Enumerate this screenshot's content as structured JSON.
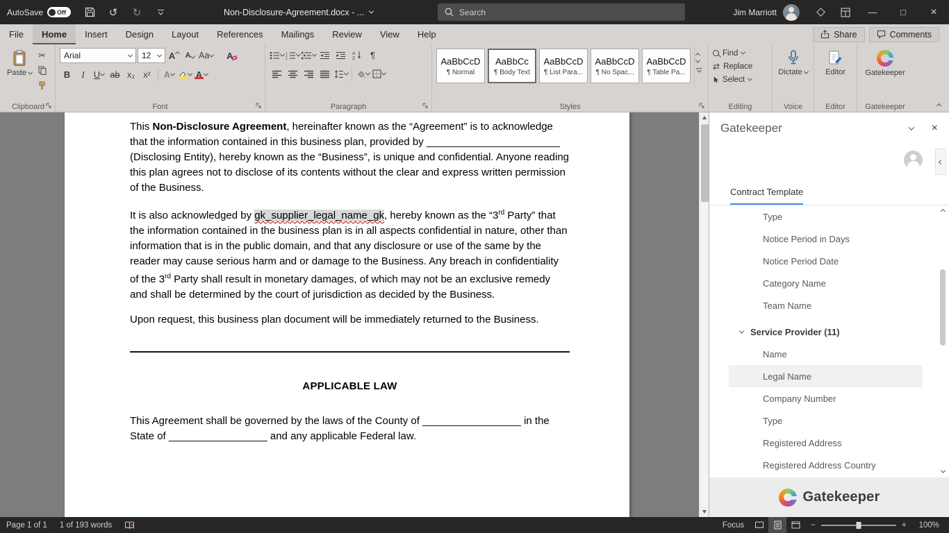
{
  "titlebar": {
    "autosave_label": "AutoSave",
    "autosave_state": "Off",
    "doc_title": "Non-Disclosure-Agreement.docx - ...",
    "search_placeholder": "Search",
    "user_name": "Jim Marriott"
  },
  "menubar": {
    "tabs": [
      "File",
      "Home",
      "Insert",
      "Design",
      "Layout",
      "References",
      "Mailings",
      "Review",
      "View",
      "Help"
    ],
    "active_tab": "Home",
    "share_label": "Share",
    "comments_label": "Comments"
  },
  "ribbon": {
    "clipboard": {
      "group_label": "Clipboard",
      "paste_label": "Paste"
    },
    "font": {
      "group_label": "Font",
      "family": "Arial",
      "size": "12"
    },
    "paragraph": {
      "group_label": "Paragraph"
    },
    "styles": {
      "group_label": "Styles",
      "items": [
        {
          "preview": "AaBbCcD",
          "label": "¶ Normal"
        },
        {
          "preview": "AaBbCc",
          "label": "¶ Body Text"
        },
        {
          "preview": "AaBbCcD",
          "label": "¶ List Para..."
        },
        {
          "preview": "AaBbCcD",
          "label": "¶ No Spac..."
        },
        {
          "preview": "AaBbCcD",
          "label": "¶ Table Pa..."
        }
      ]
    },
    "editing": {
      "group_label": "Editing",
      "find_label": "Find",
      "replace_label": "Replace",
      "select_label": "Select"
    },
    "voice": {
      "group_label": "Voice",
      "dictate_label": "Dictate"
    },
    "editor_group": {
      "group_label": "Editor",
      "button_label": "Editor"
    },
    "gatekeeper_group": {
      "group_label": "Gatekeeper",
      "button_label": "Gatekeeper"
    }
  },
  "icons": {
    "undo": "↺",
    "redo": "↻",
    "scissors": "✂",
    "pilcrow": "¶",
    "bold": "B",
    "italic": "I",
    "underline": "U",
    "strikethrough": "ab",
    "subscript": "x₂",
    "superscript": "x²",
    "text_effects": "A",
    "font_color_letter": "A",
    "change_case": "Aa",
    "grow_font_letter": "A",
    "shrink_font_letter": "A",
    "clear_format_letter": "A",
    "replace_glyph": "⇄",
    "minimize": "—",
    "maximize": "□",
    "close": "×"
  },
  "document": {
    "p1": {
      "s1": "This ",
      "bold": "Non-Disclosure Agreement",
      "s2": ", hereinafter known as the “Agreement” is to acknowledge that the information contained in this business plan, provided by ",
      "blank": "_______________________",
      "s3": " (Disclosing Entity), hereby known as the “Business”, is unique and confidential. Anyone reading this plan agrees not to disclose of its contents without the clear and express written permission of the Business."
    },
    "p2": {
      "s1": "It is also acknowledged by ",
      "tag": "gk_supplier_legal_name_gk",
      "s2": ", hereby known as the “3",
      "sup1": "rd",
      "s3": " Party” that the information contained in the business plan is in all aspects confidential in nature, other than information that is in the public domain, and that any disclosure or use of the same by the reader may cause serious harm and or damage to the Business. Any breach in confidentiality of the 3",
      "sup2": "rd",
      "s4": " Party shall result in monetary damages, of which may not be an exclusive remedy and shall be determined by the court of jurisdiction as decided by the Business."
    },
    "p3": "Upon request, this business plan document will be immediately returned to the Business.",
    "heading": "APPLICABLE LAW",
    "p4": {
      "s1": "This Agreement shall be governed by the laws of the County of ",
      "blank1": "_________________",
      "s2": " in the State of ",
      "blank2": "_________________",
      "s3": " and any applicable Federal law."
    }
  },
  "panel": {
    "title": "Gatekeeper",
    "tab": "Contract Template",
    "items": [
      "Type",
      "Notice Period in Days",
      "Notice Period Date",
      "Category Name",
      "Team Name"
    ],
    "group_label": "Service Provider (11)",
    "group_items": [
      "Name",
      "Legal Name",
      "Company Number",
      "Type",
      "Registered Address",
      "Registered Address Country"
    ],
    "selected_item": "Legal Name",
    "brand": "Gatekeeper"
  },
  "statusbar": {
    "page": "Page 1 of 1",
    "words": "1 of 193 words",
    "focus_label": "Focus",
    "zoom_level": "100%"
  }
}
